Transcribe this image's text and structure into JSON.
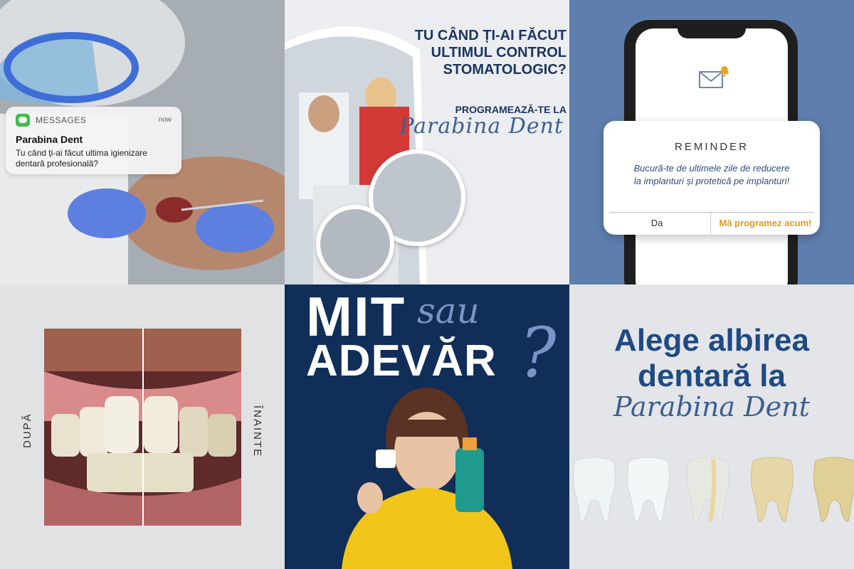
{
  "notification": {
    "app_name": "MESSAGES",
    "time": "now",
    "sender": "Parabina Dent",
    "message": "Tu când ți-ai făcut ultima igienizare dentară profesională?"
  },
  "control_post": {
    "headline": "TU CÂND ȚI-AI FĂCUT ULTIMUL CONTROL STOMATOLOGIC?",
    "cta": "PROGRAMEAZĂ-TE LA",
    "brand": "Parabina Dent"
  },
  "reminder": {
    "title": "REMINDER",
    "body": "Bucură-te de ultimele zile de reducere la implanturi și protetică pe implanturi!",
    "btn_no": "Da",
    "btn_yes": "Mă programez acum!"
  },
  "before_after": {
    "after_label": "DUPĂ",
    "before_label": "ÎNAINTE"
  },
  "myth": {
    "word1": "MIT",
    "word2": "sau",
    "word3": "ADEVĂR",
    "qmark": "?"
  },
  "whitening": {
    "headline": "Alege albirea dentară la",
    "brand": "Parabina Dent"
  },
  "colors": {
    "brand_navy": "#1a3561",
    "accent_orange": "#e09b1b",
    "tile_blue": "#5e7fae",
    "dark_navy": "#102e58"
  }
}
